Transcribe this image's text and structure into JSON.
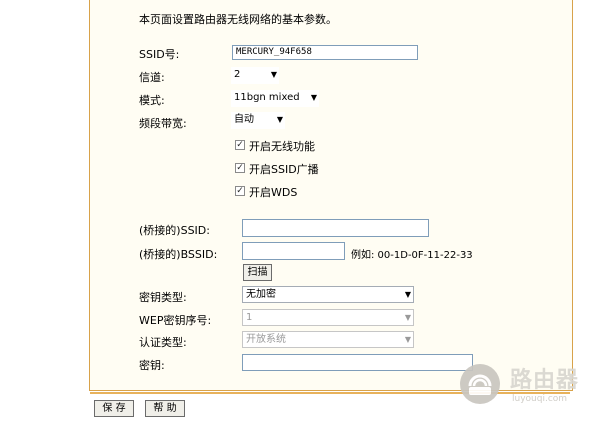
{
  "description": "本页面设置路由器无线网络的基本参数。",
  "fields": {
    "ssid_label": "SSID号:",
    "ssid_value": "MERCURY_94F658",
    "channel_label": "信道:",
    "channel_value": "2",
    "mode_label": "模式:",
    "mode_value": "11bgn mixed",
    "bandwidth_label": "频段带宽:",
    "bandwidth_value": "自动"
  },
  "checkboxes": {
    "wireless": {
      "label": "开启无线功能",
      "checked": true
    },
    "ssid_broadcast": {
      "label": "开启SSID广播",
      "checked": true
    },
    "wds": {
      "label": "开启WDS",
      "checked": true
    }
  },
  "wds": {
    "bridge_ssid_label": "(桥接的)SSID:",
    "bridge_ssid_value": "",
    "bridge_bssid_label": "(桥接的)BSSID:",
    "bridge_bssid_value": "",
    "example_text": "例如: 00-1D-0F-11-22-33",
    "scan_label": "扫描",
    "key_type_label": "密钥类型:",
    "key_type_value": "无加密",
    "wep_index_label": "WEP密钥序号:",
    "wep_index_value": "1",
    "auth_type_label": "认证类型:",
    "auth_type_value": "开放系统",
    "key_label": "密钥:",
    "key_value": ""
  },
  "buttons": {
    "save": "保 存",
    "help": "帮 助"
  },
  "watermark": {
    "main": "路由器",
    "sub": "luyouqi.com"
  },
  "colors": {
    "panel_bg": "#fffdf3",
    "panel_border": "#d8a24a",
    "input_border": "#7f9db9"
  }
}
